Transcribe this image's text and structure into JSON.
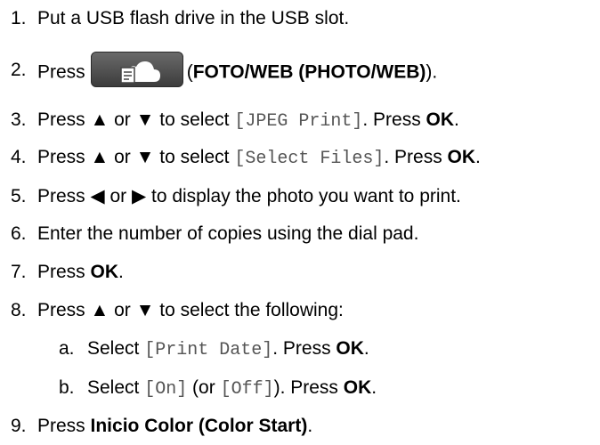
{
  "steps": [
    {
      "num": "1.",
      "text": "Put a USB flash drive in the USB slot."
    },
    {
      "num": "2.",
      "pre": "Press",
      "open": "(",
      "bold": "FOTO/WEB (PHOTO/WEB)",
      "close": ").",
      "button_icon": "photo-web-cloud-icon"
    },
    {
      "num": "3.",
      "pre": "Press ▲ or ▼ to select ",
      "code": "[JPEG Print]",
      "mid": ". Press ",
      "bold": "OK",
      "post": "."
    },
    {
      "num": "4.",
      "pre": "Press ▲ or ▼ to select ",
      "code": "[Select Files]",
      "mid": ". Press ",
      "bold": "OK",
      "post": "."
    },
    {
      "num": "5.",
      "text": "Press ◀ or ▶ to display the photo you want to print."
    },
    {
      "num": "6.",
      "text": "Enter the number of copies using the dial pad."
    },
    {
      "num": "7.",
      "pre": "Press ",
      "bold": "OK",
      "post": "."
    },
    {
      "num": "8.",
      "text": "Press ▲ or ▼ to select the following:"
    },
    {
      "num": "9.",
      "pre": "Press ",
      "bold": "Inicio Color (Color Start)",
      "post": "."
    }
  ],
  "substeps": [
    {
      "num": "a.",
      "pre": "Select ",
      "code": "[Print Date]",
      "mid": ". Press ",
      "bold": "OK",
      "post": "."
    },
    {
      "num": "b.",
      "pre": "Select ",
      "code": "[On]",
      "mid1": " (or ",
      "code2": "[Off]",
      "mid2": "). Press ",
      "bold": "OK",
      "post": "."
    }
  ]
}
